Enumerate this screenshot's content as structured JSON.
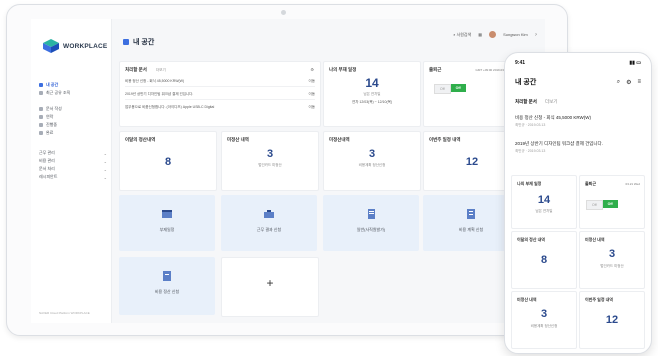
{
  "tablet": {
    "logo": "WORKPLACE",
    "page_title": "내 공간",
    "topbar": {
      "search_placeholder": "사원검색",
      "user_name": "Sungwon Kim"
    },
    "nav": {
      "items": [
        {
          "label": "내 공간",
          "active": true
        },
        {
          "label": "최근 공유 조직",
          "active": false
        }
      ],
      "items2": [
        {
          "label": "문서 작성"
        },
        {
          "label": "연락"
        },
        {
          "label": "진행중"
        },
        {
          "label": "완료"
        }
      ],
      "groups": [
        {
          "label": "근무 관리"
        },
        {
          "label": "비용 관리"
        },
        {
          "label": "문서 처리"
        },
        {
          "label": "레시피안트"
        }
      ],
      "footer": "NAVER Cloud Platform WORKPLACE"
    },
    "pending_docs": {
      "title": "처리할 문서",
      "tab": "더보기",
      "rows": [
        {
          "text": "비용 정산 신청 - 회식 45,5000 KRW(W)",
          "meta": "이동"
        },
        {
          "text": "2019년 상반기 디자인팀 워크샵 결제 건입니다.",
          "meta": "이동"
        },
        {
          "text": "업무용으로 비품신청합니다. (아이디즈) Apple USB-C Digital",
          "meta": "이동"
        }
      ]
    },
    "vacation": {
      "title": "나의 부재 일정",
      "value": "14",
      "sub": "남은 연차일",
      "detail": "연차 12/03(목) ~ 12/10(목)"
    },
    "attendance": {
      "title": "출퇴근",
      "time": "GMT +09:00 2019.03.21 Wed",
      "off": "Off",
      "on": "Off"
    },
    "cards": [
      {
        "title": "이달의 정산내역",
        "value": "8",
        "sub": ""
      },
      {
        "title": "미정산 내역",
        "value": "3",
        "sub": "법인카드 미정산"
      },
      {
        "title": "미정산내역",
        "value": "3",
        "sub": "비용계획 정산신청"
      },
      {
        "title": "이번주 일정 내역",
        "value": "12",
        "sub": ""
      }
    ],
    "tiles": [
      {
        "label": "부재일정",
        "icon": "calendar-icon"
      },
      {
        "label": "근무 결과 신청",
        "icon": "briefcase-icon"
      },
      {
        "label": "일반(사직원발가)",
        "icon": "document-icon"
      },
      {
        "label": "비용 계획 신청",
        "icon": "checklist-icon"
      },
      {
        "label": "비용 정산 신청",
        "icon": "receipt-icon"
      },
      {
        "label": "+",
        "icon": "plus-icon"
      }
    ]
  },
  "phone": {
    "time": "9:41",
    "title": "내 공간",
    "tabs": [
      {
        "label": "처리할 문서"
      },
      {
        "label": "더보기"
      }
    ],
    "items": [
      {
        "title": "비용 정산 신청 - 회식 45,5000 KRW(W)",
        "meta": "최민규 · 2019.03.13"
      },
      {
        "title": "2019년 상반기 디자인팀 워크샵 결제 건입니다.",
        "meta": "최민규 · 2019.03.13"
      }
    ],
    "vacation": {
      "title": "나의 부재 일정",
      "value": "14",
      "sub": "남은 연차일"
    },
    "attendance": {
      "title": "출퇴근",
      "time": "03.21 Wed",
      "off": "Off",
      "on": "Off"
    },
    "cards": [
      {
        "title": "이달의 정산 내역",
        "value": "8",
        "sub": ""
      },
      {
        "title": "미정산 내역",
        "value": "3",
        "sub": "법인카드 미정산"
      },
      {
        "title": "미정산 내역",
        "value": "3",
        "sub": "비용계획 정산신청"
      },
      {
        "title": "이번주 일정 내역",
        "value": "12",
        "sub": ""
      }
    ]
  },
  "colors": {
    "accent": "#2b4a8d",
    "tile_bg": "#e8f0fa",
    "toggle_on": "#2fae4b"
  }
}
